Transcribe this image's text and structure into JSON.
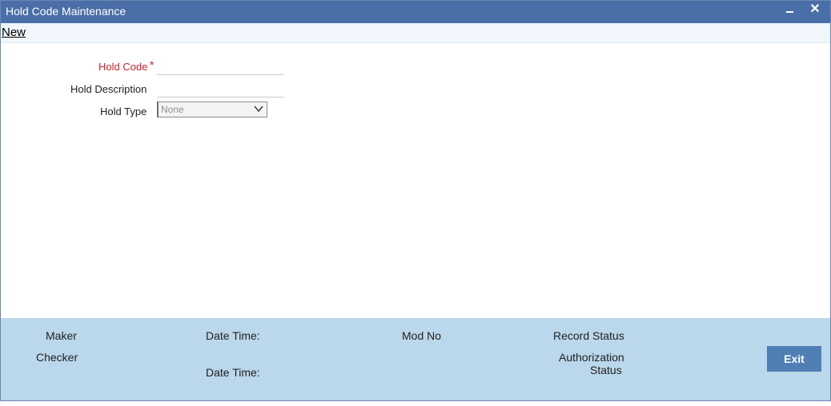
{
  "window": {
    "title": "Hold Code Maintenance"
  },
  "toolbar": {
    "new_label": "New"
  },
  "form": {
    "hold_code": {
      "label": "Hold Code",
      "required_marker": "*",
      "value": ""
    },
    "hold_description": {
      "label": "Hold Description",
      "value": ""
    },
    "hold_type": {
      "label": "Hold Type",
      "selected": "None"
    }
  },
  "footer": {
    "maker_label": "Maker",
    "checker_label": "Checker",
    "date_time_label_1": "Date Time:",
    "date_time_label_2": "Date Time:",
    "mod_no_label": "Mod No",
    "record_status_label": "Record Status",
    "authorization_label_line1": "Authorization",
    "authorization_label_line2": "Status",
    "exit_label": "Exit"
  },
  "colors": {
    "titlebar": "#4a6fa8",
    "footer": "#bad7eb",
    "required": "#cc1f2b",
    "exit_button": "#4f7fb5"
  },
  "icons": {
    "minimize": "minimize-icon",
    "close": "close-icon",
    "dropdown": "chevron-down-icon"
  }
}
